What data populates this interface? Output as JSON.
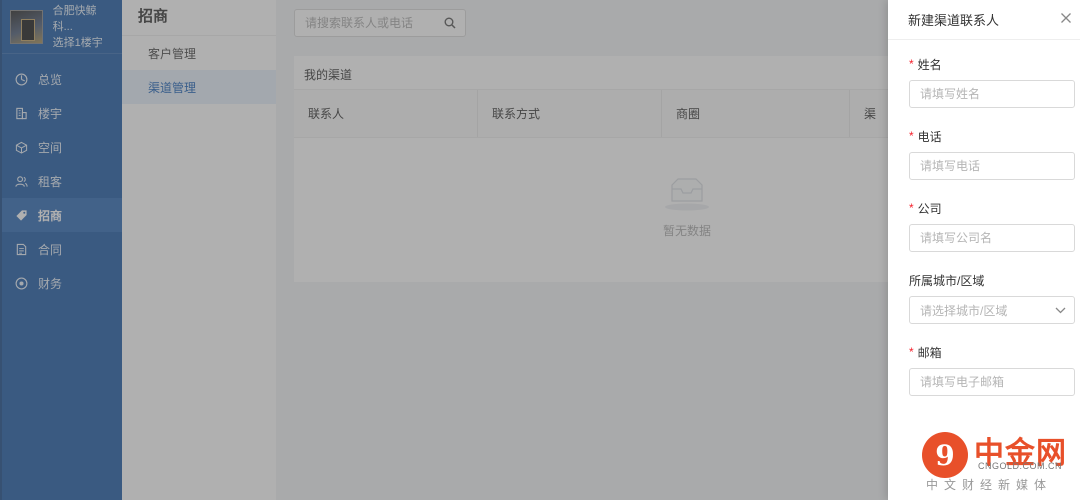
{
  "brand": {
    "name": "合肥快鲸科...",
    "building_select": "选择1楼宇"
  },
  "nav": {
    "items": [
      {
        "label": "总览",
        "icon": "dashboard-icon"
      },
      {
        "label": "楼宇",
        "icon": "building-icon"
      },
      {
        "label": "空间",
        "icon": "cube-icon"
      },
      {
        "label": "租客",
        "icon": "users-icon"
      },
      {
        "label": "招商",
        "icon": "tag-icon",
        "active": true
      },
      {
        "label": "合同",
        "icon": "document-icon"
      },
      {
        "label": "财务",
        "icon": "finance-icon"
      }
    ]
  },
  "submenu": {
    "title": "招商",
    "items": [
      {
        "label": "客户管理"
      },
      {
        "label": "渠道管理",
        "active": true
      }
    ]
  },
  "main": {
    "search": {
      "placeholder": "请搜索联系人或电话"
    },
    "card_title": "我的渠道",
    "columns": [
      "联系人",
      "联系方式",
      "商圈",
      "渠"
    ],
    "empty_text": "暂无数据"
  },
  "drawer": {
    "title": "新建渠道联系人",
    "fields": [
      {
        "label": "姓名",
        "required": true,
        "placeholder": "请填写姓名"
      },
      {
        "label": "电话",
        "required": true,
        "placeholder": "请填写电话"
      },
      {
        "label": "公司",
        "required": true,
        "placeholder": "请填写公司名"
      },
      {
        "label": "所属城市/区域",
        "required": false,
        "placeholder": "请选择城市/区域"
      },
      {
        "label": "邮箱",
        "required": true,
        "placeholder": "请填写电子邮箱"
      }
    ],
    "required_mark": "*"
  },
  "watermark": {
    "name": "中金网",
    "domain": "CNGOLD.COM.CN",
    "tagline": "中文财经新媒体"
  },
  "colors": {
    "sidebar": "#1d5ba6",
    "active": "#1d63b8",
    "required": "#f5222d",
    "watermark": "#e8502a"
  }
}
